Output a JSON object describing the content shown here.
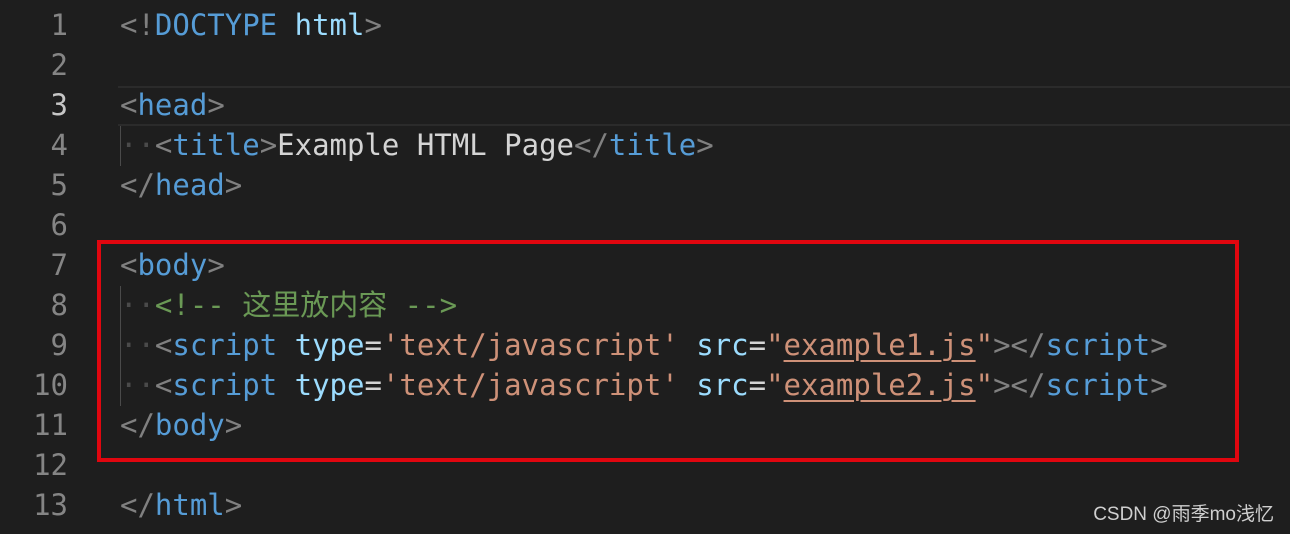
{
  "editor": {
    "lines": [
      {
        "num": "1",
        "tokens": [
          {
            "t": "<!",
            "k": "p"
          },
          {
            "t": "DOCTYPE",
            "k": "t"
          },
          {
            "t": " ",
            "k": "tx"
          },
          {
            "t": "html",
            "k": "a"
          },
          {
            "t": ">",
            "k": "p"
          }
        ]
      },
      {
        "num": "2",
        "tokens": []
      },
      {
        "num": "3",
        "tokens": [
          {
            "t": "<",
            "k": "p"
          },
          {
            "t": "head",
            "k": "t"
          },
          {
            "t": ">",
            "k": "p"
          }
        ]
      },
      {
        "num": "4",
        "tokens": [
          {
            "t": "··",
            "k": "ws"
          },
          {
            "t": "<",
            "k": "p"
          },
          {
            "t": "title",
            "k": "t"
          },
          {
            "t": ">",
            "k": "p"
          },
          {
            "t": "Example HTML Page",
            "k": "tx"
          },
          {
            "t": "</",
            "k": "p"
          },
          {
            "t": "title",
            "k": "t"
          },
          {
            "t": ">",
            "k": "p"
          }
        ]
      },
      {
        "num": "5",
        "tokens": [
          {
            "t": "</",
            "k": "p"
          },
          {
            "t": "head",
            "k": "t"
          },
          {
            "t": ">",
            "k": "p"
          }
        ]
      },
      {
        "num": "6",
        "tokens": []
      },
      {
        "num": "7",
        "tokens": [
          {
            "t": "<",
            "k": "p"
          },
          {
            "t": "body",
            "k": "t"
          },
          {
            "t": ">",
            "k": "p"
          }
        ]
      },
      {
        "num": "8",
        "tokens": [
          {
            "t": "··",
            "k": "ws"
          },
          {
            "t": "<!-- 这里放内容 -->",
            "k": "c"
          }
        ]
      },
      {
        "num": "9",
        "tokens": [
          {
            "t": "··",
            "k": "ws"
          },
          {
            "t": "<",
            "k": "p"
          },
          {
            "t": "script",
            "k": "t"
          },
          {
            "t": " ",
            "k": "tx"
          },
          {
            "t": "type",
            "k": "a"
          },
          {
            "t": "=",
            "k": "tx"
          },
          {
            "t": "'text/javascript'",
            "k": "s"
          },
          {
            "t": " ",
            "k": "tx"
          },
          {
            "t": "src",
            "k": "a"
          },
          {
            "t": "=",
            "k": "tx"
          },
          {
            "t": "\"",
            "k": "s"
          },
          {
            "t": "example1.js",
            "k": "s",
            "u": true
          },
          {
            "t": "\"",
            "k": "s"
          },
          {
            "t": "></",
            "k": "p"
          },
          {
            "t": "script",
            "k": "t"
          },
          {
            "t": ">",
            "k": "p"
          }
        ]
      },
      {
        "num": "10",
        "tokens": [
          {
            "t": "··",
            "k": "ws"
          },
          {
            "t": "<",
            "k": "p"
          },
          {
            "t": "script",
            "k": "t"
          },
          {
            "t": " ",
            "k": "tx"
          },
          {
            "t": "type",
            "k": "a"
          },
          {
            "t": "=",
            "k": "tx"
          },
          {
            "t": "'text/javascript'",
            "k": "s"
          },
          {
            "t": " ",
            "k": "tx"
          },
          {
            "t": "src",
            "k": "a"
          },
          {
            "t": "=",
            "k": "tx"
          },
          {
            "t": "\"",
            "k": "s"
          },
          {
            "t": "example2.js",
            "k": "s",
            "u": true
          },
          {
            "t": "\"",
            "k": "s"
          },
          {
            "t": "></",
            "k": "p"
          },
          {
            "t": "script",
            "k": "t"
          },
          {
            "t": ">",
            "k": "p"
          }
        ]
      },
      {
        "num": "11",
        "tokens": [
          {
            "t": "</",
            "k": "p"
          },
          {
            "t": "body",
            "k": "t"
          },
          {
            "t": ">",
            "k": "p"
          }
        ]
      },
      {
        "num": "12",
        "tokens": []
      },
      {
        "num": "13",
        "tokens": [
          {
            "t": "</",
            "k": "p"
          },
          {
            "t": "html",
            "k": "t"
          },
          {
            "t": ">",
            "k": "p"
          }
        ]
      }
    ],
    "active_line": "3"
  },
  "watermark": {
    "text": "CSDN @雨季mo浅忆"
  },
  "colors": {
    "background": "#1e1e1e",
    "highlight_box": "#e0060f",
    "tag": "#569cd6",
    "attribute": "#9cdcfe",
    "string": "#ce9178",
    "comment": "#6a9955"
  }
}
